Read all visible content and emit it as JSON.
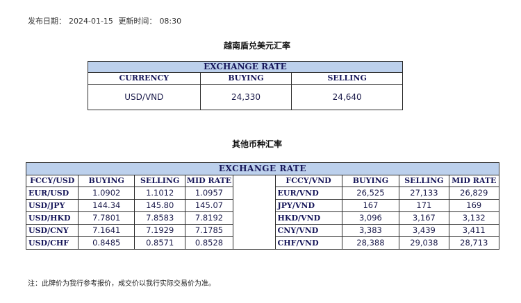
{
  "meta": {
    "publish_label": "发布日期：",
    "publish_date": "2024-01-15",
    "update_label": "更新时间：",
    "update_time": "08:30"
  },
  "section1": {
    "title": "越南盾兑美元汇率",
    "table_title": "EXCHANGE RATE",
    "columns": [
      "CURRENCY",
      "BUYING",
      "SELLING"
    ],
    "rows": [
      [
        "USD/VND",
        "24,330",
        "24,640"
      ]
    ]
  },
  "section2": {
    "title": "其他币种汇率",
    "table_title": "EXCHANGE  RATE",
    "left_columns": [
      "FCCY/USD",
      "BUYING",
      "SELLING",
      "MID RATE"
    ],
    "right_columns": [
      "FCCY/VND",
      "BUYING",
      "SELLING",
      "MID RATE"
    ],
    "left_rows": [
      [
        "EUR/USD",
        "1.0902",
        "1.1012",
        "1.0957"
      ],
      [
        "USD/JPY",
        "144.34",
        "145.80",
        "145.07"
      ],
      [
        "USD/HKD",
        "7.7801",
        "7.8583",
        "7.8192"
      ],
      [
        "USD/CNY",
        "7.1641",
        "7.1929",
        "7.1785"
      ],
      [
        "USD/CHF",
        "0.8485",
        "0.8571",
        "0.8528"
      ]
    ],
    "right_rows": [
      [
        "EUR/VND",
        "26,525",
        "27,133",
        "26,829"
      ],
      [
        "JPY/VND",
        "167",
        "171",
        "169"
      ],
      [
        "HKD/VND",
        "3,096",
        "3,167",
        "3,132"
      ],
      [
        "CNY/VND",
        "3,383",
        "3,439",
        "3,411"
      ],
      [
        "CHF/VND",
        "28,388",
        "29,038",
        "28,713"
      ]
    ]
  },
  "note": "注：此牌价为我行参考报价，成交价以我行实际交易价为准。"
}
